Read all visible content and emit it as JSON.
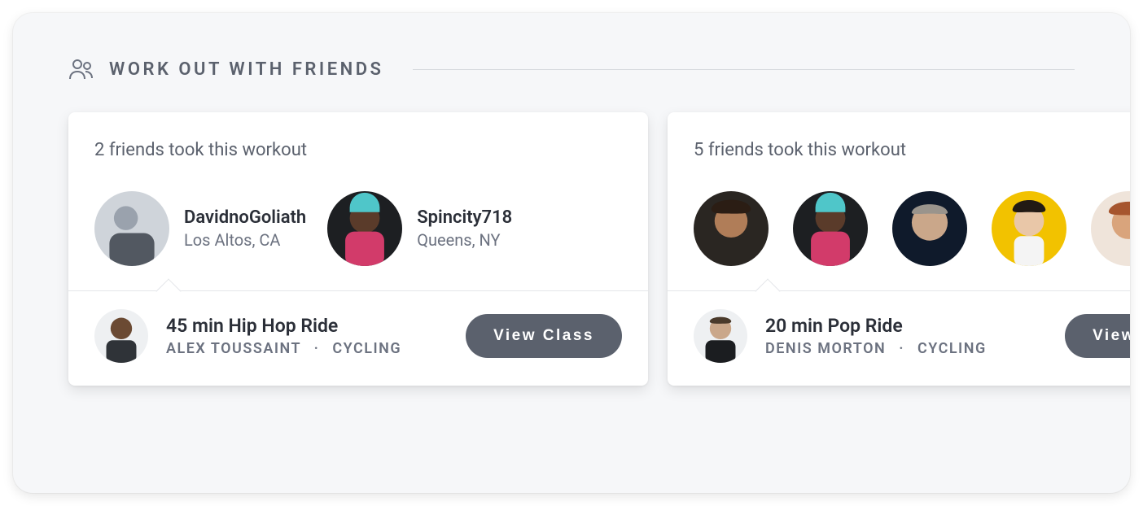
{
  "section": {
    "title": "Work Out With Friends"
  },
  "cards": [
    {
      "friends_count_text": "2 friends took this workout",
      "friends": [
        {
          "name": "DavidnoGoliath",
          "location": "Los Altos, CA"
        },
        {
          "name": "Spincity718",
          "location": "Queens, NY"
        }
      ],
      "class": {
        "title": "45 min Hip Hop Ride",
        "instructor": "Alex Toussaint",
        "category": "Cycling",
        "button": "View Class"
      }
    },
    {
      "friends_count_text": "5 friends took this workout",
      "friends": [
        {},
        {},
        {},
        {},
        {}
      ],
      "class": {
        "title": "20 min Pop Ride",
        "instructor": "Denis Morton",
        "category": "Cycling",
        "button": "View Class"
      }
    }
  ],
  "meta_separator": "·"
}
